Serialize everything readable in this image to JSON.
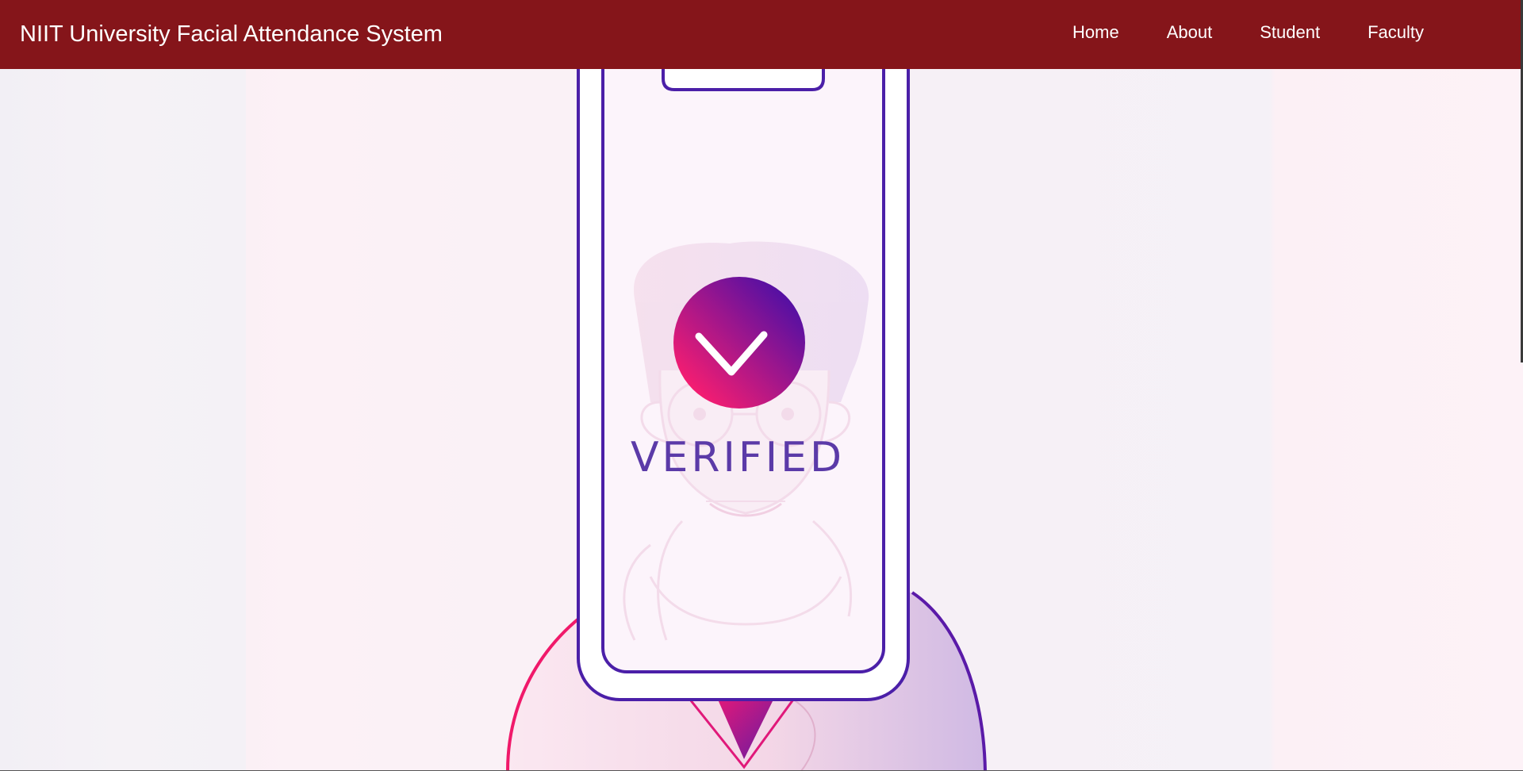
{
  "navbar": {
    "brand": "NIIT University Facial Attendance System",
    "links": [
      {
        "label": "Home"
      },
      {
        "label": "About"
      },
      {
        "label": "Student"
      },
      {
        "label": "Faculty"
      }
    ]
  },
  "hero": {
    "status_text": "VERIFIED",
    "icon": "checkmark-icon"
  },
  "colors": {
    "navbar_bg": "#85151a",
    "accent_purple": "#4b1fa8",
    "accent_pink": "#f0196a"
  }
}
